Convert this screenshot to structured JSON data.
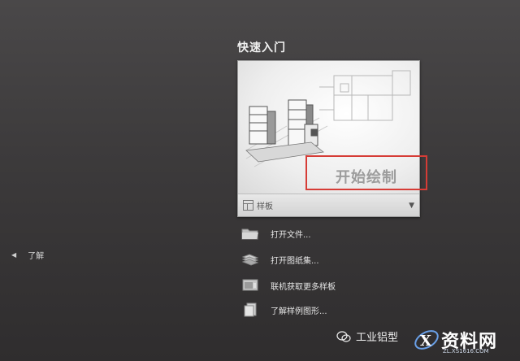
{
  "nav": {
    "learn_label": "了解",
    "arrow": "◀"
  },
  "quick_start": {
    "title": "快速入门",
    "start_drawing_label": "开始绘制",
    "template_label": "样板",
    "template_dropdown": "▼",
    "actions": [
      {
        "label": "打开文件...",
        "icon": "folder-icon"
      },
      {
        "label": "打开图纸集...",
        "icon": "sheet-set-icon"
      },
      {
        "label": "联机获取更多样板",
        "icon": "online-templates-icon"
      },
      {
        "label": "了解样例图形...",
        "icon": "sample-drawing-icon"
      }
    ]
  },
  "watermark": {
    "account": "工业铝型",
    "brand": "资料网",
    "brand_url": "ZL.XS1616.COM"
  },
  "colors": {
    "highlight": "#d63c36",
    "background": "#3c3a3b"
  }
}
